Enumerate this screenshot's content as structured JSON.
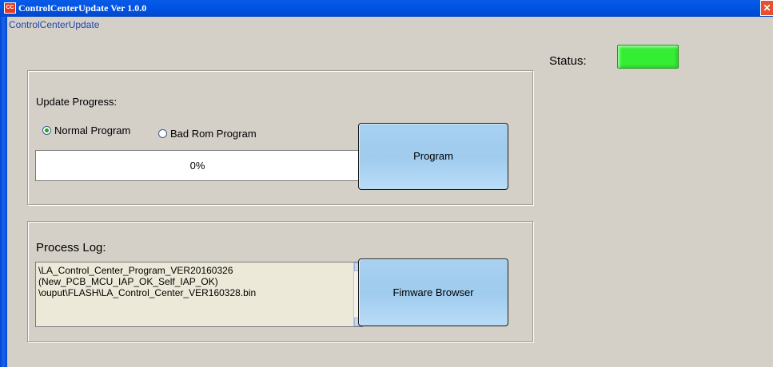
{
  "window": {
    "title": "ControlCenterUpdate  Ver 1.0.0",
    "icon_text": "CC",
    "close_symbol": "✕",
    "form_label": "ControlCenterUpdate"
  },
  "status": {
    "label": "Status:",
    "indicator_color": "#33ee33"
  },
  "update": {
    "title": "Update Progress:",
    "radio_options": [
      {
        "label": "Normal Program",
        "selected": true
      },
      {
        "label": "Bad Rom Program",
        "selected": false
      }
    ],
    "progress_text": "0%",
    "progress_value": 0,
    "program_button": "Program"
  },
  "log": {
    "title": "Process Log:",
    "lines": "\\LA_Control_Center_Program_VER20160326\n(New_PCB_MCU_IAP_OK_Self_IAP_OK)\n\\ouput\\FLASH\\LA_Control_Center_VER160328.bin",
    "firmware_button": "Fimware Browser"
  },
  "colors": {
    "titlebar": "#0055e5",
    "button": "#a8d0f0",
    "status_led": "#33ee33"
  }
}
